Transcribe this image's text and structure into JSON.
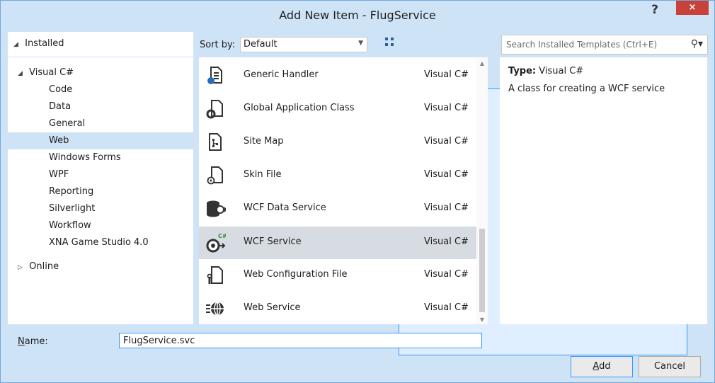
{
  "window": {
    "title": "Add New Item - FlugService",
    "help_label": "?",
    "close_label": "×"
  },
  "installed_header": {
    "label": "Installed"
  },
  "tree": {
    "root": "Visual C#",
    "children": [
      "Code",
      "Data",
      "General",
      "Web",
      "Windows Forms",
      "WPF",
      "Reporting",
      "Silverlight",
      "Workflow",
      "XNA Game Studio 4.0"
    ],
    "selected": "Web",
    "online": "Online"
  },
  "sort": {
    "label": "Sort by:",
    "value": "Default"
  },
  "search": {
    "placeholder": "Search Installed Templates (Ctrl+E)"
  },
  "templates": [
    {
      "name": "Generic Handler",
      "language": "Visual C#",
      "icon": "generic-handler-icon"
    },
    {
      "name": "Global Application Class",
      "language": "Visual C#",
      "icon": "global-application-class-icon"
    },
    {
      "name": "Site Map",
      "language": "Visual C#",
      "icon": "site-map-icon"
    },
    {
      "name": "Skin File",
      "language": "Visual C#",
      "icon": "skin-file-icon"
    },
    {
      "name": "WCF Data Service",
      "language": "Visual C#",
      "icon": "wcf-data-service-icon"
    },
    {
      "name": "WCF Service",
      "language": "Visual C#",
      "icon": "wcf-service-icon",
      "selected": true
    },
    {
      "name": "Web Configuration File",
      "language": "Visual C#",
      "icon": "web-configuration-file-icon"
    },
    {
      "name": "Web Service",
      "language": "Visual C#",
      "icon": "web-service-icon"
    }
  ],
  "details": {
    "type_label": "Type:",
    "type_value": "Visual C#",
    "description": "A class for creating a WCF service"
  },
  "name_field": {
    "label": "Name:",
    "value": "FlugService.svc"
  },
  "buttons": {
    "add": "Add",
    "cancel": "Cancel"
  },
  "colors": {
    "accent": "#3399ff",
    "selection": "#cfe3f7",
    "close": "#c8413a"
  }
}
